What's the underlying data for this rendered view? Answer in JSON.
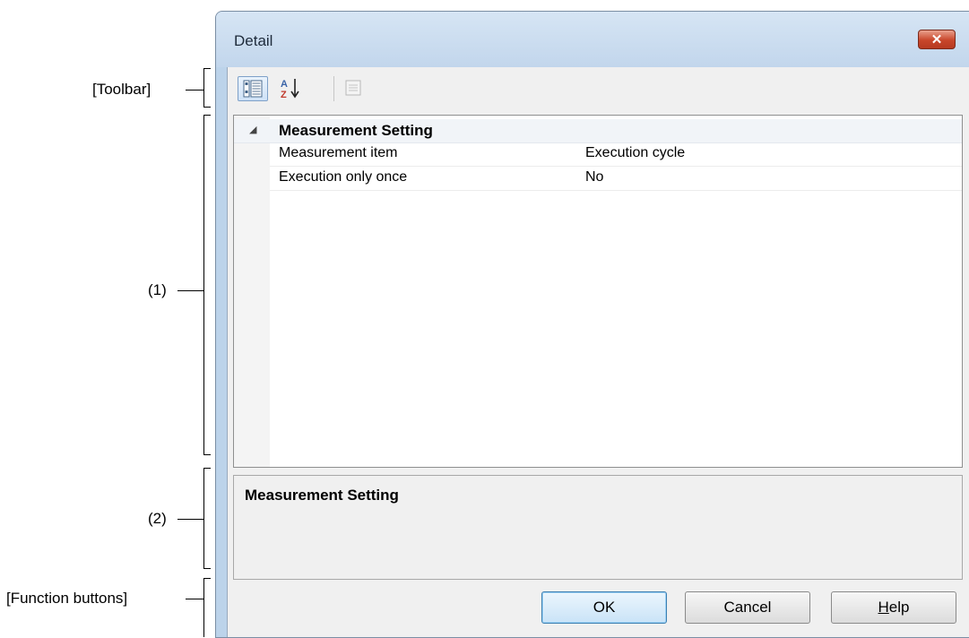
{
  "annotations": {
    "toolbar": "[Toolbar]",
    "property_area": "(1)",
    "description_area": "(2)",
    "function_buttons": "[Function buttons]"
  },
  "dialog": {
    "title": "Detail",
    "close_icon": "close-x-icon"
  },
  "toolbar": {
    "buttons": [
      {
        "icon": "categorized-view-icon",
        "active": true
      },
      {
        "icon": "sort-alphabetical-icon",
        "active": false
      },
      {
        "icon": "property-pages-icon",
        "active": false,
        "disabled": true
      }
    ]
  },
  "property_grid": {
    "category": {
      "label": "Measurement Setting",
      "expanded": true,
      "properties": [
        {
          "name": "Measurement item",
          "value": "Execution cycle"
        },
        {
          "name": "Execution only once",
          "value": "No"
        }
      ]
    }
  },
  "description": {
    "title": "Measurement Setting"
  },
  "buttons": {
    "ok": "OK",
    "cancel": "Cancel",
    "help_mnemonic": "H",
    "help_rest": "elp"
  },
  "colors": {
    "window_frame": "#bcd3ea",
    "close_button": "#c8462a",
    "client_bg": "#f0f0f0"
  }
}
